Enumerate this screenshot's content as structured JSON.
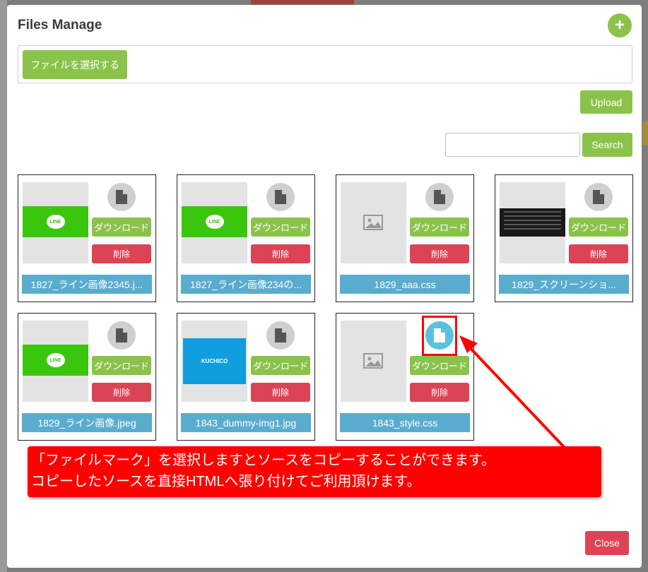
{
  "modal": {
    "title": "Files Manage",
    "add_label": "+",
    "choose_label": "ファイルを選択する",
    "upload_label": "Upload",
    "search_placeholder": "",
    "search_label": "Search",
    "close_label": "Close"
  },
  "files": [
    {
      "name": "1827_ライン画像2345.j...",
      "thumb": "line",
      "download": "ダウンロード",
      "delete": "削除",
      "icon_active": false
    },
    {
      "name": "1827_ライン画像234の...",
      "thumb": "line",
      "download": "ダウンロード",
      "delete": "削除",
      "icon_active": false
    },
    {
      "name": "1829_aaa.css",
      "thumb": "placeholder",
      "download": "ダウンロード",
      "delete": "削除",
      "icon_active": false
    },
    {
      "name": "1829_スクリーンショ...",
      "thumb": "screenshot",
      "download": "ダウンロード",
      "delete": "削除",
      "icon_active": false
    },
    {
      "name": "1829_ライン画像.jpeg",
      "thumb": "line",
      "download": "ダウンロード",
      "delete": "削除",
      "icon_active": false
    },
    {
      "name": "1843_dummy-img1.jpg",
      "thumb": "kuchico",
      "download": "ダウンロード",
      "delete": "削除",
      "icon_active": false
    },
    {
      "name": "1843_style.css",
      "thumb": "placeholder",
      "download": "ダウンロード",
      "delete": "削除",
      "icon_active": true
    }
  ],
  "thumb_texts": {
    "line": "LINE",
    "kuchico": "KUCHICO"
  },
  "callout": {
    "line1": "「ファイルマーク」を選択しますとソースをコピーすることができます。",
    "line2": "コピーしたソースを直接HTMLへ張り付けてご利用頂けます。"
  },
  "colors": {
    "accent_green": "#8bc34a",
    "danger_red": "#dc4455",
    "filename_blue": "#5aacce",
    "callout_red": "#ff0000",
    "active_icon": "#5bc0de"
  }
}
